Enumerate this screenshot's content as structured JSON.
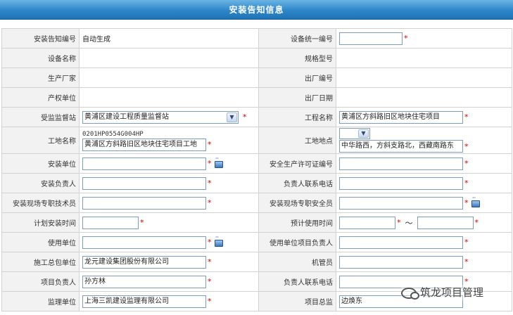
{
  "window": {
    "title": "安装告知信息"
  },
  "colors": {
    "header_blue": "#2d86c8",
    "label_bg": "#f2f2f2",
    "required": "#e00000",
    "input_border": "#7f9db9"
  },
  "icons": {
    "picker": "picker-icon",
    "dropdown": "chevron-down-icon"
  },
  "required_mark": "*",
  "range_sep": "～",
  "fields": {
    "notice_no": {
      "label": "安装告知编号",
      "value": "自动生成"
    },
    "device_unified_no": {
      "label": "设备统一编号",
      "value": ""
    },
    "device_name": {
      "label": "设备名称",
      "value": ""
    },
    "spec_model": {
      "label": "规格型号",
      "value": ""
    },
    "manufacturer": {
      "label": "生产厂家",
      "value": ""
    },
    "factory_no": {
      "label": "出厂编号",
      "value": ""
    },
    "owner_unit": {
      "label": "产权单位",
      "value": ""
    },
    "factory_date": {
      "label": "出厂日期",
      "value": ""
    },
    "supervision_station": {
      "label": "受监监督站",
      "value": "黄浦区建设工程质量监督站"
    },
    "project_name": {
      "label": "工程名称",
      "value": "黄浦区方斜路旧区地块住宅项目"
    },
    "site_name": {
      "label": "工地名称",
      "code": "0201HP0554G004HP",
      "value": "黄浦区方斜路旧区地块住宅项目工地"
    },
    "site_address": {
      "label": "工地地点",
      "district": "",
      "value": "中华路西，方斜支路北，西藏南路东"
    },
    "install_unit": {
      "label": "安装单位",
      "value": ""
    },
    "safety_permit_no": {
      "label": "安全生产许可证编号",
      "value": ""
    },
    "install_manager": {
      "label": "安装负责人",
      "value": ""
    },
    "manager_phone": {
      "label": "负责人联系电话",
      "value": ""
    },
    "onsite_technician": {
      "label": "安装现场专职技术员",
      "value": ""
    },
    "onsite_safety_officer": {
      "label": "安装现场专职安全员",
      "value": ""
    },
    "planned_install_time": {
      "label": "计划安装时间",
      "value": ""
    },
    "expected_use_time": {
      "label": "预计使用时间",
      "from": "",
      "to": ""
    },
    "user_unit": {
      "label": "使用单位",
      "value": ""
    },
    "user_project_manager": {
      "label": "使用单位项目负责人",
      "value": ""
    },
    "general_contractor": {
      "label": "施工总包单位",
      "value": "龙元建设集团股份有限公司"
    },
    "equipment_admin": {
      "label": "机管员",
      "value": ""
    },
    "project_manager": {
      "label": "项目负责人",
      "value": "孙方林"
    },
    "pm_phone": {
      "label": "负责人联系电话",
      "value": ""
    },
    "supervisor_unit": {
      "label": "监理单位",
      "value": "上海三凯建设监理有限公司"
    },
    "chief_supervisor": {
      "label": "项目总监",
      "value": "边焕东"
    }
  },
  "watermark": {
    "text": "筑龙项目管理"
  }
}
